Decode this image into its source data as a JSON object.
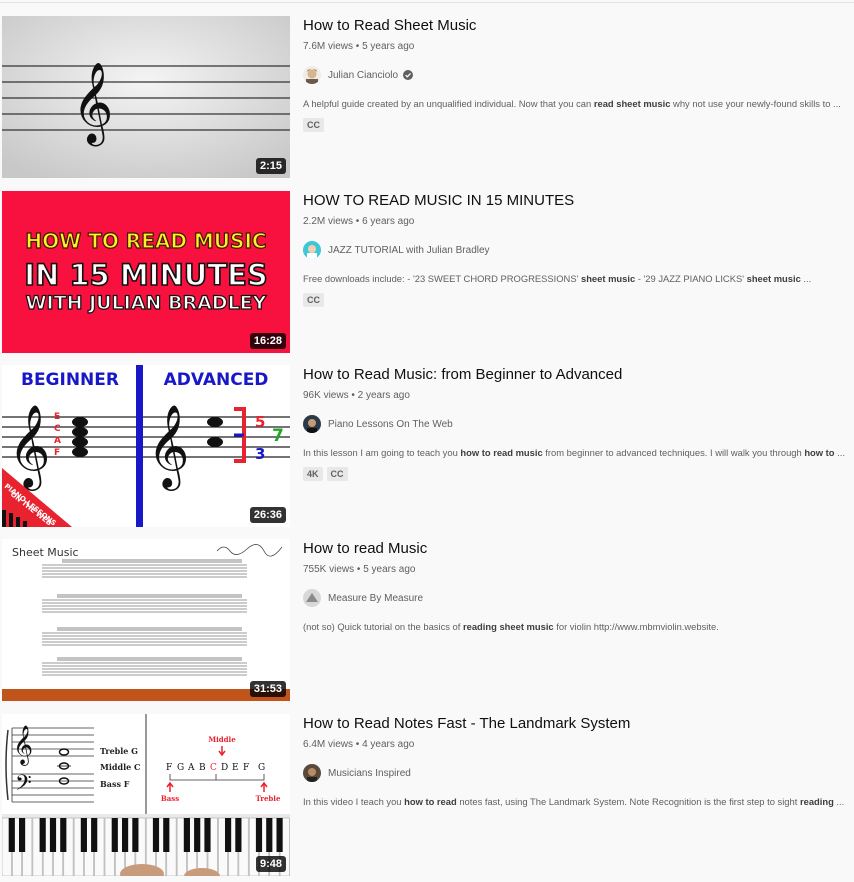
{
  "results": [
    {
      "title": "How to Read Sheet Music",
      "views": "7.6M views",
      "age": "5 years ago",
      "channel": "Julian Cianciolo",
      "verified": true,
      "duration": "2:15",
      "desc_pre": "A helpful guide created by an unqualified individual. Now that you can ",
      "desc_b1": "read sheet music",
      "desc_mid": " why not use your newly-found skills to ...",
      "desc_b2": "",
      "desc_post": "",
      "badges": [
        "CC"
      ]
    },
    {
      "title": "HOW TO READ MUSIC IN 15 MINUTES",
      "views": "2.2M views",
      "age": "6 years ago",
      "channel": "JAZZ TUTORIAL with Julian Bradley",
      "verified": false,
      "duration": "16:28",
      "desc_pre": "Free downloads include: - '23 SWEET CHORD PROGRESSIONS' ",
      "desc_b1": "sheet music",
      "desc_mid": " - '29 JAZZ PIANO LICKS' ",
      "desc_b2": "sheet music",
      "desc_post": " ...",
      "badges": [
        "CC"
      ],
      "thumb_text": [
        "HOW TO READ MUSIC",
        "IN 15 MINUTES",
        "WITH JULIAN BRADLEY"
      ]
    },
    {
      "title": "How to Read Music: from Beginner to Advanced",
      "views": "96K views",
      "age": "2 years ago",
      "channel": "Piano Lessons On The Web",
      "verified": false,
      "duration": "26:36",
      "desc_pre": "In this lesson I am going to teach you ",
      "desc_b1": "how to read music",
      "desc_mid": " from beginner to advanced techniques. I will walk you through ",
      "desc_b2": "how to",
      "desc_post": " ...",
      "badges": [
        "4K",
        "CC"
      ],
      "thumb_text": [
        "BEGINNER",
        "ADVANCED",
        "E",
        "C",
        "A",
        "F",
        "5",
        "7",
        "3",
        "PIANO LESSONS",
        "ON THE WEB"
      ]
    },
    {
      "title": "How to read Music",
      "views": "755K views",
      "age": "5 years ago",
      "channel": "Measure By Measure",
      "verified": false,
      "duration": "31:53",
      "desc_pre": "(not so) Quick tutorial on the basics of ",
      "desc_b1": "reading sheet music",
      "desc_mid": " for violin http://www.mbmviolin.website.",
      "desc_b2": "",
      "desc_post": "",
      "badges": [],
      "thumb_text": [
        "Sheet Music"
      ]
    },
    {
      "title": "How to Read Notes Fast - The Landmark System",
      "views": "6.4M views",
      "age": "4 years ago",
      "channel": "Musicians Inspired",
      "verified": false,
      "duration": "9:48",
      "desc_pre": "In this video I teach you ",
      "desc_b1": "how to read",
      "desc_mid": " notes fast, using The Landmark System. Note Recognition is the first step to sight ",
      "desc_b2": "reading",
      "desc_post": " ...",
      "badges": [],
      "thumb_text": [
        "Treble G",
        "Middle C",
        "Bass F",
        "Middle",
        "F",
        "G",
        "A",
        "B",
        "C",
        "D",
        "E",
        "F",
        "G",
        "Bass",
        "Treble"
      ]
    }
  ],
  "colors": {
    "red_thumb": "#f8113e",
    "yellow_text": "#ffee2a",
    "blue": "#1818c8",
    "red_accent": "#e8222e",
    "green": "#26a626",
    "brown_bar": "#c0541a"
  }
}
